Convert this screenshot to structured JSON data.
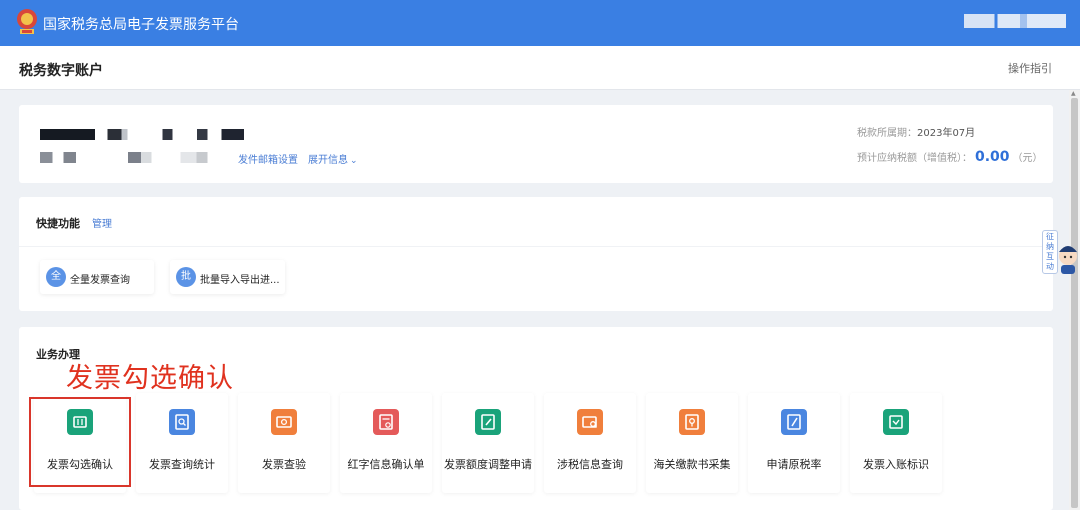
{
  "header": {
    "site_title": "国家税务总局电子发票服务平台",
    "logo": "tax-bureau-emblem-icon"
  },
  "subheader": {
    "account_title": "税务数字账户",
    "guide_link": "操作指引"
  },
  "info": {
    "mail_settings_link": "发件邮箱设置",
    "expand_link": "展开信息",
    "period_label": "税款所属期：",
    "period_value": "2023年07月",
    "tax_label": "预计应纳税额（增值税）：",
    "tax_amount": "0.00",
    "tax_unit": "（元）"
  },
  "quick": {
    "title": "快捷功能",
    "manage": "管理",
    "items": [
      {
        "badge": "全",
        "label": "全量发票查询"
      },
      {
        "badge": "批",
        "label": "批量导入导出进..."
      }
    ]
  },
  "business": {
    "title": "业务办理",
    "annotation": "发票勾选确认",
    "tiles": [
      {
        "label": "发票勾选确认",
        "icon": "ticket-check-icon",
        "color": "#1aa37a"
      },
      {
        "label": "发票查询统计",
        "icon": "search-document-icon",
        "color": "#4a86e0"
      },
      {
        "label": "发票查验",
        "icon": "ticket-verify-icon",
        "color": "#f07f3c"
      },
      {
        "label": "红字信息确认单",
        "icon": "red-info-form-icon",
        "color": "#e45a5a"
      },
      {
        "label": "发票额度调整申请",
        "icon": "quota-edit-icon",
        "color": "#1aa37a"
      },
      {
        "label": "涉税信息查询",
        "icon": "tax-info-search-icon",
        "color": "#f07f3c"
      },
      {
        "label": "海关缴款书采集",
        "icon": "customs-payment-icon",
        "color": "#f07f3c"
      },
      {
        "label": "申请原税率",
        "icon": "apply-rate-icon",
        "color": "#4a86e0"
      },
      {
        "label": "发票入账标识",
        "icon": "invoice-account-icon",
        "color": "#1aa37a"
      }
    ]
  },
  "assistant": {
    "bubble_text": "征纳互动",
    "icon": "customer-service-avatar-icon"
  }
}
